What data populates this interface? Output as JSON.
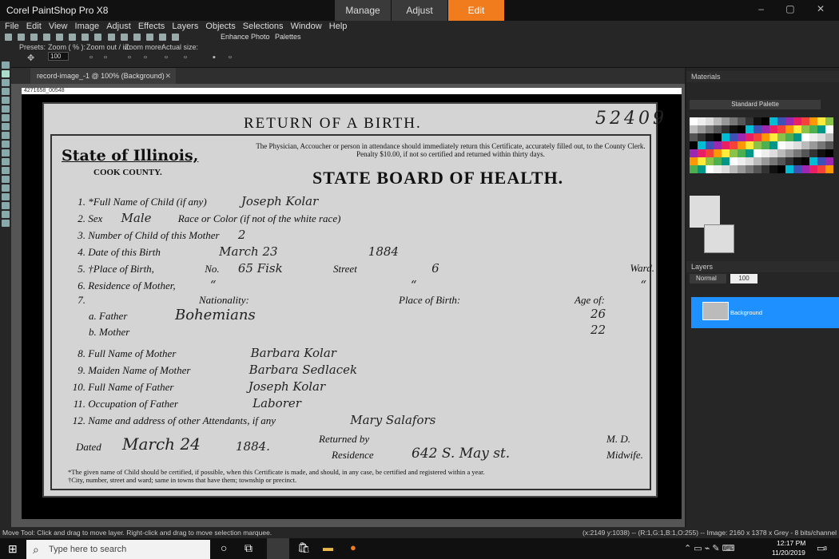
{
  "app": {
    "title": "Corel PaintShop Pro X8"
  },
  "workspace_tabs": [
    {
      "label": "Manage"
    },
    {
      "label": "Adjust"
    },
    {
      "label": "Edit"
    }
  ],
  "menu": [
    "File",
    "Edit",
    "View",
    "Image",
    "Adjust",
    "Effects",
    "Layers",
    "Objects",
    "Selections",
    "Window",
    "Help"
  ],
  "toolbar1": {
    "enhance_label": "Enhance Photo",
    "palettes_label": "Palettes"
  },
  "toolbar2": {
    "presets": "Presets:",
    "zoom": "Zoom ( % ):",
    "zoom_value": "100",
    "zoom_out_in": "Zoom out / in:",
    "zoom_more": "Zoom more:",
    "actual_size": "Actual size:"
  },
  "document_tab": {
    "label": "record-image_-1 @ 100% (Background)"
  },
  "filename_strip": "4271658_00548",
  "certificate": {
    "title": "RETURN OF A BIRTH.",
    "number": "52409",
    "state": "State of Illinois,",
    "county": "COOK COUNTY.",
    "notice": "The Physician, Accoucher or person in attendance should immediately return this Certificate, accurately filled out, to the County Clerk. Penalty $10.00, if not so certified and returned within thirty days.",
    "board": "STATE BOARD OF HEALTH.",
    "rows": [
      {
        "num": "1.",
        "label": "*Full Name of Child (if any)",
        "value": "Joseph Kolar"
      },
      {
        "num": "2.",
        "label": "Sex",
        "value": "Male",
        "label2": "Race or Color (if not of the white race)"
      },
      {
        "num": "3.",
        "label": "Number of Child of this Mother",
        "value": "2"
      },
      {
        "num": "4.",
        "label": "Date of this Birth",
        "value": "March 23",
        "value2": "1884"
      },
      {
        "num": "5.",
        "label": "†Place of Birth,",
        "no_label": "No.",
        "value": "65 Fisk",
        "street_label": "Street",
        "value2": "6",
        "ward_label": "Ward."
      },
      {
        "num": "6.",
        "label": "Residence of Mother,",
        "value": "“",
        "value2": "“",
        "value3": "“"
      }
    ],
    "row7": {
      "num": "7.",
      "nationality": "Nationality:",
      "place_of_birth": "Place of Birth:",
      "age_of": "Age of:",
      "father_label": "a. Father",
      "father_value": "Bohemians",
      "father_age": "26",
      "mother_label": "b. Mother",
      "mother_age": "22"
    },
    "rows2": [
      {
        "num": "8.",
        "label": "Full Name of Mother",
        "value": "Barbara Kolar"
      },
      {
        "num": "9.",
        "label": "Maiden Name of Mother",
        "value": "Barbara Sedlacek"
      },
      {
        "num": "10.",
        "label": "Full Name of Father",
        "value": "Joseph Kolar"
      },
      {
        "num": "11.",
        "label": "Occupation of Father",
        "value": "Laborer"
      },
      {
        "num": "12.",
        "label": "Name and address of other Attendants, if any",
        "value": "Mary Salafors"
      }
    ],
    "dated_label": "Dated",
    "dated_value": "March 24",
    "dated_year": "1884.",
    "returned_by": "Returned by",
    "residence_label": "Residence",
    "residence_value": "642 S. May st.",
    "md": "M. D.",
    "midwife": "Midwife.",
    "footnote1": "*The given name of Child should be certified, if possible, when this Certificate is made, and should, in any case, be certified and registered within a year.",
    "footnote2": "†City, number, street and ward; same in towns that have them; township or precinct."
  },
  "panels": {
    "materials": "Materials",
    "standard_palette": "Standard Palette",
    "layers": "Layers",
    "blend_mode": "Normal",
    "opacity": "100",
    "layer_name": "Background"
  },
  "status": {
    "left": "Move Tool: Click and drag to move layer. Right-click and drag to move selection marquee.",
    "right": "(x:2149 y:1038) -- (R:1,G:1,B:1,O:255) -- Image: 2160 x 1378 x Grey - 8 bits/channel"
  },
  "taskbar": {
    "search_placeholder": "Type here to search",
    "time": "12:17 PM",
    "date": "11/20/2019",
    "notifications": "3"
  },
  "colors": {
    "accent": "#f07c1e",
    "selected_layer": "#1e90ff"
  }
}
